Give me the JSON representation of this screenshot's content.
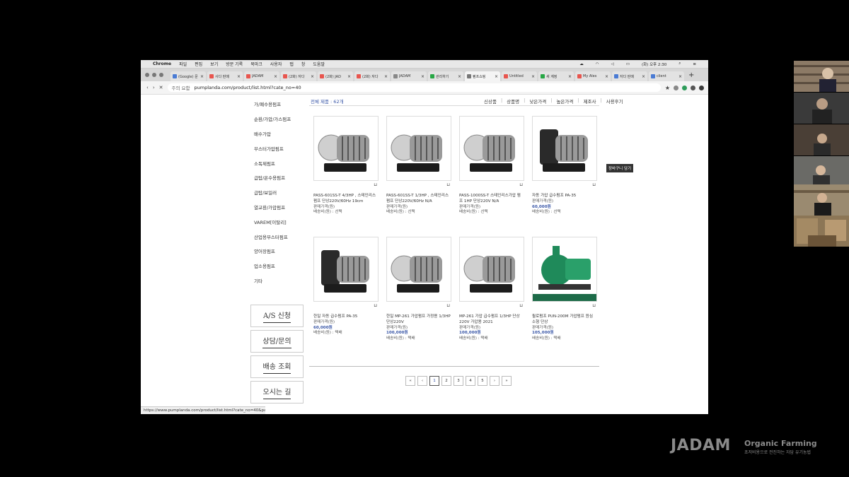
{
  "mac_menu": {
    "app": "Chrome",
    "items": [
      "파일",
      "편집",
      "보기",
      "방문 기록",
      "북마크",
      "사용자",
      "탭",
      "창",
      "도움말"
    ],
    "clock": "(화) 오후 2:30"
  },
  "tabs": [
    {
      "title": "(Google) 문",
      "color": "#4a7bd4"
    },
    {
      "title": "사다 판매",
      "color": "#e8554e"
    },
    {
      "title": "JADAM",
      "color": "#e8554e"
    },
    {
      "title": "(2화) 자다",
      "color": "#e8554e"
    },
    {
      "title": "(2화) JAD",
      "color": "#e8554e"
    },
    {
      "title": "(2화) 자다",
      "color": "#e8554e"
    },
    {
      "title": "JADAM",
      "color": "#888888"
    },
    {
      "title": "관리하기",
      "color": "#27a745"
    },
    {
      "title": "펌프쇼핑",
      "color": "#777777",
      "active": true
    },
    {
      "title": "Untitled",
      "color": "#e8554e"
    },
    {
      "title": "새 계정",
      "color": "#27a745"
    },
    {
      "title": "My Ales",
      "color": "#e8554e"
    },
    {
      "title": "자다 판매",
      "color": "#4a7bd4"
    },
    {
      "title": "client",
      "color": "#4a7bd4"
    }
  ],
  "address": {
    "secure": "주의 요함",
    "url": "pumplanda.com/product/list.html?cate_no=40"
  },
  "sidebar": {
    "categories": [
      "가/폐수용펌프",
      "순환/가압/가스펌프",
      "배수가압",
      "부스터가압펌프",
      "소독제펌프",
      "급탑/온수용펌프",
      "급탑/보일러",
      "열교환/가압펌프",
      "VAREM[이탈리]",
      "산업용부스터펌프",
      "양어장펌프",
      "업소용펌프",
      "기타"
    ],
    "boxes": [
      "A/S 신청",
      "상담/문의",
      "배송 조회",
      "오시는 길"
    ]
  },
  "list": {
    "total": "전체 제품 : 62개",
    "sort": [
      "신상품",
      "상품명",
      "낮은가격",
      "높은가격",
      "제조사",
      "사용후기"
    ]
  },
  "products": [
    {
      "name": "PASS-601SS-T 4/3HP , 스테인리스 펌프 단상220V/60Hz 19cm",
      "sub": "판매가격(원)",
      "meta": "배송비(원) : 선택"
    },
    {
      "name": "PASS-601SS-T 1/3HP , 스테인리스 펌프 단상220V/60Hz N/A",
      "sub": "판매가격(원)",
      "meta": "배송비(원) : 선택"
    },
    {
      "name": "PASS-1000SS-T 스테인리스가압 펌프 1HP 단상220V N/A",
      "sub": "판매가격(원)",
      "meta": "배송비(원) : 선택"
    },
    {
      "name": "자동 가압 급수펌프 PA-35",
      "sub": "판매가격(원)",
      "price": "60,000원",
      "meta": "배송비(원) : 선택"
    },
    {
      "name": "한일 자동 급수펌프 PA-35",
      "sub": "판매가격(원)",
      "price": "60,000원",
      "meta": "배송비(원) : 택배"
    },
    {
      "name": "한일 MP-261 가압펌프 가정용 1/3HP 단상220V",
      "sub": "판매가격(원)",
      "price": "100,000원",
      "meta": "배송비(원) : 택배"
    },
    {
      "name": "MP-261 가압 급수펌프 1/3HP 단상220V 가압용 2021",
      "sub": "판매가격(원)",
      "price": "100,000원",
      "meta": "배송비(원) : 택배"
    },
    {
      "name": "윌로펌프 PUN-200M 가압펌프 원심 소형 단상",
      "sub": "판매가격(원)",
      "price": "105,000원",
      "meta": "배송비(원) : 택배"
    }
  ],
  "tooltip": "장바구니 담기",
  "pager": [
    "«",
    "‹",
    "1",
    "2",
    "3",
    "4",
    "5",
    "›",
    "»"
  ],
  "status_url": "https://www.pumplanda.com/product/list.html?cate_no=40&page=2",
  "watermark": {
    "brand": "JADAM",
    "side": "Organic Farming",
    "sub": "초저비용으로 전진하는 자담 유기농법"
  },
  "colors": {
    "accent_blue": "#3b58a8",
    "green_pump": "#1f8a5a"
  }
}
